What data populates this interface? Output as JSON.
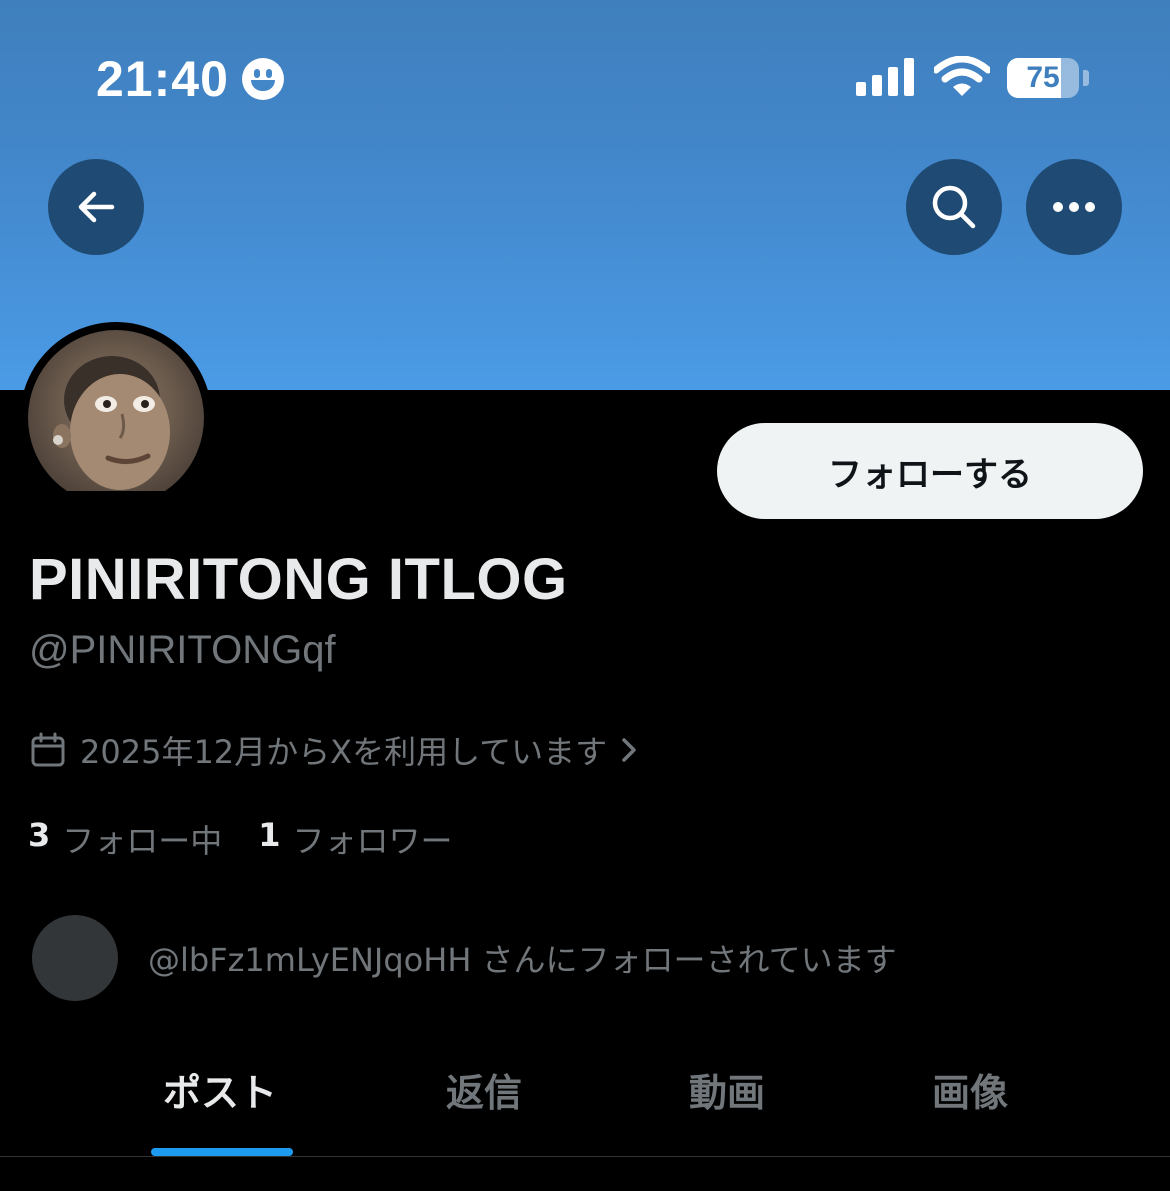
{
  "status_bar": {
    "time": "21:40",
    "battery_percent": "75",
    "battery_level": 0.75,
    "icons": [
      "smiley-icon",
      "signal-icon",
      "wifi-icon",
      "battery-icon"
    ]
  },
  "colors": {
    "banner": "#4a96e0",
    "background": "#000000",
    "accent": "#1d9bf0",
    "secondary_text": "#71767b",
    "round_button": "#1f4a73"
  },
  "nav": {
    "back_icon": "arrow-left-icon",
    "search_icon": "search-icon",
    "more_icon": "more-horizontal-icon"
  },
  "profile": {
    "follow_button_label": "フォローする",
    "display_name": "PINIRITONG ITLOG",
    "handle": "@PINIRITONGqf",
    "joined_text": "2025年12月からXを利用しています",
    "following_count": "3",
    "following_label": "フォロー中",
    "followers_count": "1",
    "followers_label": "フォロワー",
    "followed_by_text": "@lbFz1mLyENJqoHH さんにフォローされています"
  },
  "tabs": [
    {
      "label": "ポスト",
      "active": true
    },
    {
      "label": "返信",
      "active": false
    },
    {
      "label": "動画",
      "active": false
    },
    {
      "label": "画像",
      "active": false
    }
  ]
}
